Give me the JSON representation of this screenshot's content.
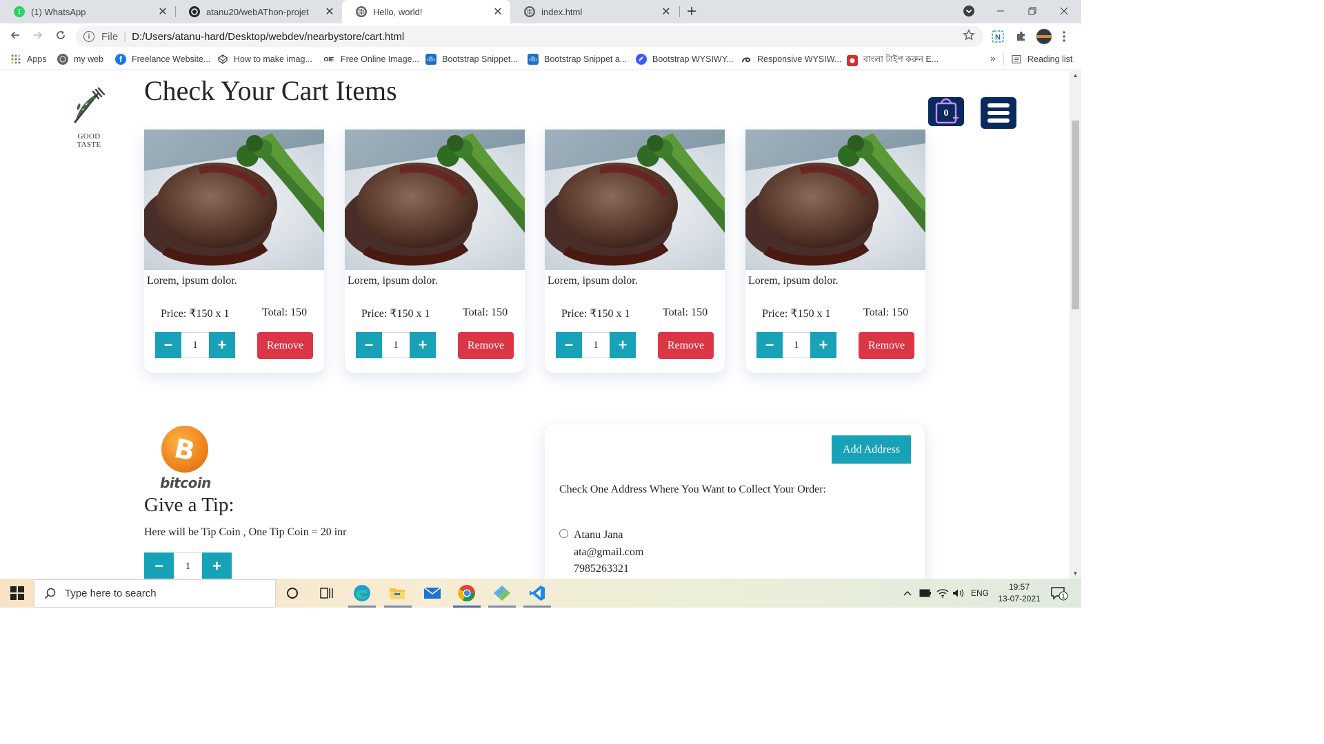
{
  "browser": {
    "tabs": [
      {
        "title": "(1) WhatsApp",
        "icon": "whatsapp-icon",
        "active": false
      },
      {
        "title": "atanu20/webAThon-projet",
        "icon": "github-icon",
        "active": false
      },
      {
        "title": "Hello, world!",
        "icon": "globe-icon",
        "active": true
      },
      {
        "title": "index.html",
        "icon": "globe-icon",
        "active": false
      }
    ],
    "whatsapp_badge": "1",
    "close_glyph": "✕",
    "new_tab_glyph": "+",
    "address_scheme": "File",
    "address_url": "D:/Users/atanu-hard/Desktop/webdev/nearbystore/cart.html",
    "bookmarks": [
      {
        "label": "Apps",
        "icon": "apps-grid-icon"
      },
      {
        "label": "my web",
        "icon": "globe-icon"
      },
      {
        "label": "Freelance Website...",
        "icon": "facebook-icon"
      },
      {
        "label": "How to make imag...",
        "icon": "codepen-icon"
      },
      {
        "label": "Free Online Image...",
        "icon": "oie-icon"
      },
      {
        "label": "Bootstrap Snippet...",
        "icon": "bootstrap-snippet-icon"
      },
      {
        "label": "Bootstrap Snippet a...",
        "icon": "bootstrap-snippet-icon"
      },
      {
        "label": "Bootstrap WYSIWY...",
        "icon": "wysiwyg-icon"
      },
      {
        "label": "Responsive WYSIW...",
        "icon": "swirl-icon"
      },
      {
        "label": "বাংলা টাইপ করুন E...",
        "icon": "bengali-icon"
      }
    ],
    "bookmark_overflow": "»",
    "reading_list": "Reading list"
  },
  "page": {
    "logo_text": "GOOD TASTE",
    "title": "Check Your Cart Items",
    "cart_count": "0",
    "cart_items": [
      {
        "name": "Lorem, ipsum dolor.",
        "price": "Price: ₹150 x 1",
        "total": "Total: 150",
        "qty": "1",
        "remove": "Remove"
      },
      {
        "name": "Lorem, ipsum dolor.",
        "price": "Price: ₹150 x 1",
        "total": "Total: 150",
        "qty": "1",
        "remove": "Remove"
      },
      {
        "name": "Lorem, ipsum dolor.",
        "price": "Price: ₹150 x 1",
        "total": "Total: 150",
        "qty": "1",
        "remove": "Remove"
      },
      {
        "name": "Lorem, ipsum dolor.",
        "price": "Price: ₹150 x 1",
        "total": "Total: 150",
        "qty": "1",
        "remove": "Remove"
      }
    ],
    "minus_glyph": "−",
    "plus_glyph": "+",
    "bitcoin_word": "bitcoin",
    "bitcoin_letter": "B",
    "tip_heading": "Give a Tip:",
    "tip_description": "Here will be Tip Coin , One Tip Coin = 20 inr",
    "tip_qty": "1",
    "add_address_label": "Add Address",
    "address_prompt": "Check One Address Where You Want to Collect Your Order:",
    "address": {
      "name": "Atanu Jana",
      "email": "ata@gmail.com",
      "phone": "7985263321"
    }
  },
  "taskbar": {
    "search_placeholder": "Type here to search",
    "language": "ENG",
    "time": "19:57",
    "date": "13-07-2021",
    "notification_count": "1"
  },
  "colors": {
    "accent_teal": "#17a2b8",
    "danger_red": "#dc3545",
    "navy": "#0a2a5e",
    "bitcoin_orange": "#f7931a"
  }
}
